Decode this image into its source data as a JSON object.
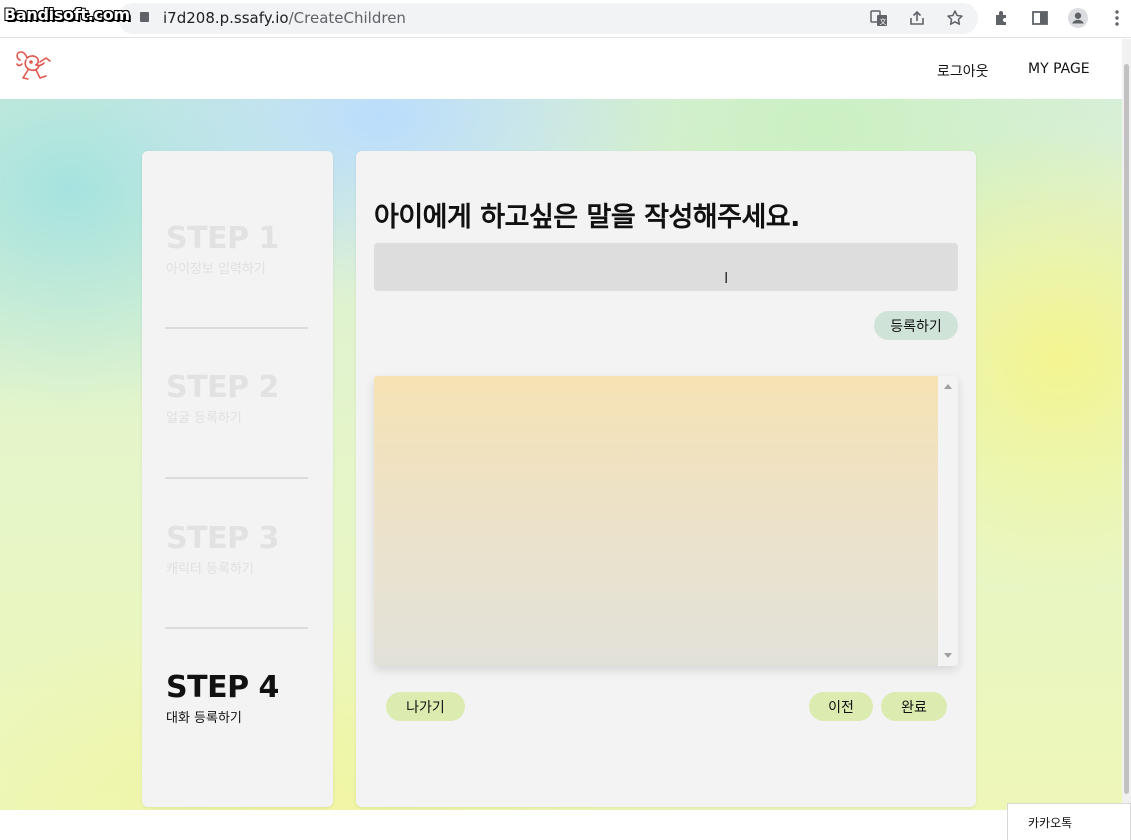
{
  "browser": {
    "watermark": "Bandisoft.com",
    "url_host": "i7d208.p.ssafy.io",
    "url_path": "/CreateChildren",
    "icons": [
      "translate-icon",
      "share-icon",
      "star-icon",
      "extensions-icon",
      "sidepanel-icon",
      "profile-icon",
      "menu-icon"
    ]
  },
  "header": {
    "logo": "logo-icon",
    "logout_label": "로그아웃",
    "mypage_label": "MY PAGE"
  },
  "steps": [
    {
      "title": "STEP 1",
      "subtitle": "아이정보 입력하기",
      "active": false
    },
    {
      "title": "STEP 2",
      "subtitle": "얼굴 등록하기",
      "active": false
    },
    {
      "title": "STEP 3",
      "subtitle": "캐릭터 등록하기",
      "active": false
    },
    {
      "title": "STEP 4",
      "subtitle": "대화 등록하기",
      "active": true
    }
  ],
  "main": {
    "title": "아이에게 하고싶은 말을 작성해주세요.",
    "input_value": "",
    "register_label": "등록하기",
    "exit_label": "나가기",
    "prev_label": "이전",
    "done_label": "완료"
  },
  "taskbar": {
    "kakao_label": "카카오톡"
  },
  "colors": {
    "pill_green": "#dcebb0",
    "register_pill": "#cfe3d8",
    "input_bg": "#dddddd",
    "panel_bg": "#f3f3f3",
    "logo_red": "#e0574f"
  }
}
